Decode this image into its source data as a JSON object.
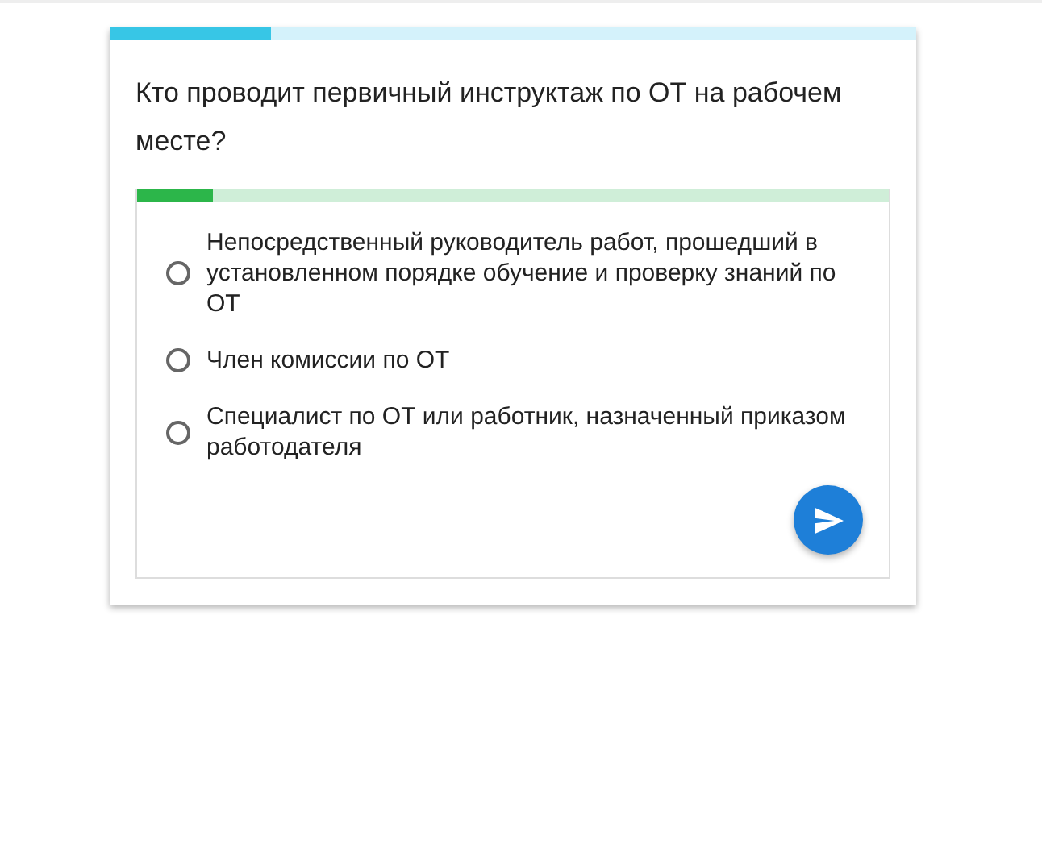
{
  "quiz_progress": {
    "level": 0.2
  },
  "question": "Кто проводит первичный инструктаж по ОТ на рабочем месте?",
  "answer_progress": {
    "level": 0.1
  },
  "options": [
    {
      "label": "Непосредственный руководитель работ, прошедший в установленном порядке обучение и проверку знаний по ОТ",
      "selected": false
    },
    {
      "label": "Член комиссии по ОТ",
      "selected": false
    },
    {
      "label": "Специалист по ОТ или работник, назначенный приказом работодателя",
      "selected": false
    }
  ]
}
